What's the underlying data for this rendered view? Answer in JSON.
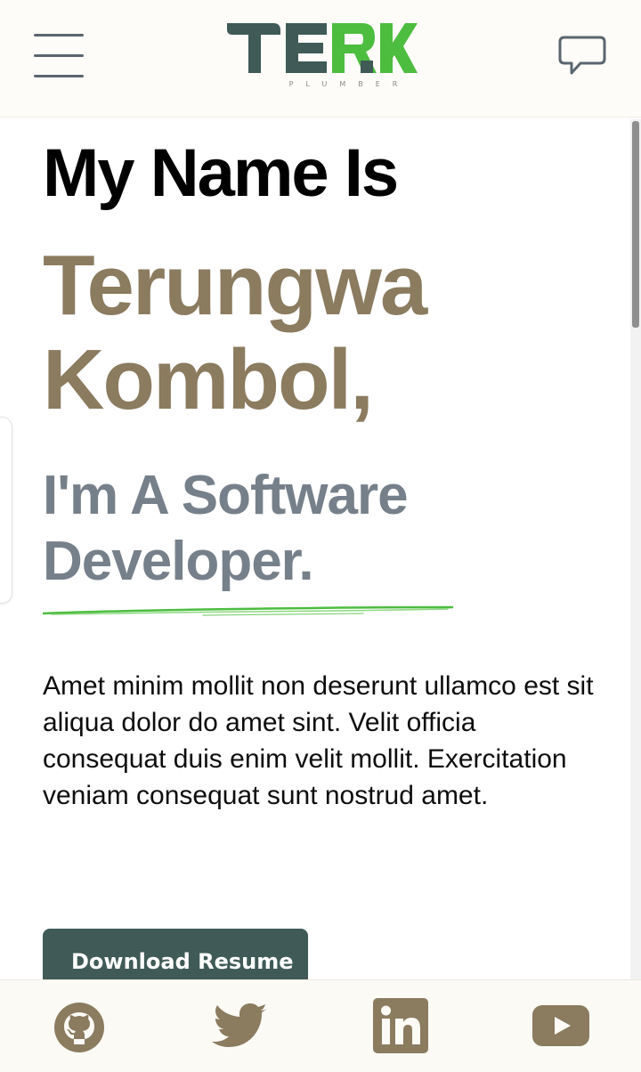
{
  "header": {
    "logo_text": "TERK",
    "logo_subtitle": "PLUMBER"
  },
  "hero": {
    "intro": "My Name Is",
    "name_line1": "Terungwa",
    "name_line2": "Kombol,",
    "role_line1": "I'm A Software",
    "role_line2": "Developer.",
    "bio": "Amet minim mollit non deserunt ullamco est sit aliqua dolor do amet sint. Velit officia consequat duis enim velit mollit. Exercitation veniam consequat sunt nostrud amet.",
    "download_label": "Download Resume"
  },
  "colors": {
    "accent_brown": "#8b7b5f",
    "accent_gray": "#76808a",
    "button_bg": "#3f5a57",
    "logo_dark": "#3f5a57",
    "logo_green": "#4cbd3f"
  },
  "icons": {
    "menu": "hamburger-icon",
    "chat": "chat-bubble-icon",
    "social": [
      "github-icon",
      "twitter-icon",
      "linkedin-icon",
      "youtube-icon"
    ]
  }
}
